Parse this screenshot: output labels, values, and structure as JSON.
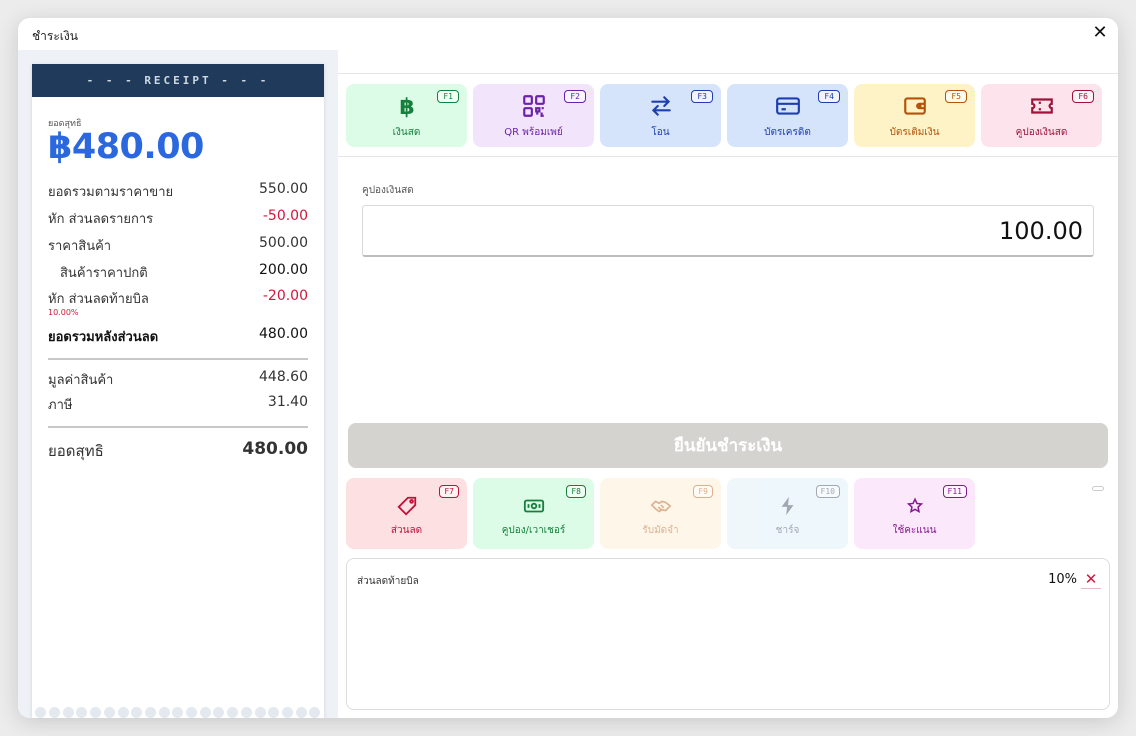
{
  "dialog": {
    "title": "ชำระเงิน",
    "close_symbol": "✕"
  },
  "receipt": {
    "header": "- - - RECEIPT - - -",
    "net_label": "ยอดสุทธิ",
    "net_amount": "฿480.00",
    "rows": {
      "gross_label": "ยอดรวมตามราคาขาย",
      "gross_value": "550.00",
      "item_disc_label": "หัก ส่วนลดรายการ",
      "item_disc_value": "-50.00",
      "product_label": "ราคาสินค้า",
      "product_value": "500.00",
      "regular_label": "สินค้าราคาปกติ",
      "regular_value": "200.00",
      "bill_disc_label": "หัก ส่วนลดท้ายบิล",
      "bill_disc_value": "-20.00",
      "bill_disc_pct": "10.00%",
      "after_disc_label": "ยอดรวมหลังส่วนลด",
      "after_disc_value": "480.00",
      "goods_label": "มูลค่าสินค้า",
      "goods_value": "448.60",
      "tax_label": "ภาษี",
      "tax_value": "31.40",
      "total_label": "ยอดสุทธิ",
      "total_value": "480.00"
    }
  },
  "payment_methods": [
    {
      "label": "เงินสด",
      "fkey": "F1",
      "icon": "baht-icon"
    },
    {
      "label": "QR พร้อมเพย์",
      "fkey": "F2",
      "icon": "qr-code-icon"
    },
    {
      "label": "โอน",
      "fkey": "F3",
      "icon": "transfer-arrows-icon"
    },
    {
      "label": "บัตรเครดิต",
      "fkey": "F4",
      "icon": "credit-card-icon"
    },
    {
      "label": "บัตรเติมเงิน",
      "fkey": "F5",
      "icon": "wallet-icon"
    },
    {
      "label": "คูปองเงินสด",
      "fkey": "F6",
      "icon": "ticket-icon"
    }
  ],
  "coupon_field": {
    "label": "คูปองเงินสด",
    "value": "100.00"
  },
  "confirm_button": "ยืนยันชำระเงิน",
  "adjustments": [
    {
      "label": "ส่วนลด",
      "fkey": "F7",
      "icon": "tag-icon"
    },
    {
      "label": "คูปอง/เวาเชอร์",
      "fkey": "F8",
      "icon": "voucher-icon"
    },
    {
      "label": "รับมัดจำ",
      "fkey": "F9",
      "icon": "handshake-icon"
    },
    {
      "label": "ชาร์จ",
      "fkey": "F10",
      "icon": "bolt-icon"
    },
    {
      "label": "ใช้คะแนน",
      "fkey": "F11",
      "icon": "star-icon"
    }
  ],
  "applied": {
    "label": "ส่วนลดท้ายบิล",
    "value": "10%",
    "remove_symbol": "✕"
  },
  "colors": {
    "accent_blue": "#2b68e0",
    "receipt_header": "#1f3a5a",
    "negative_red": "#d0183c",
    "confirm_disabled": "#d4d3cf"
  }
}
